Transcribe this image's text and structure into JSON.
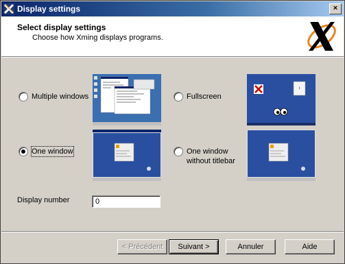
{
  "window": {
    "title": "Display settings",
    "close_glyph": "×"
  },
  "header": {
    "title": "Select display settings",
    "subtitle": "Choose how Xming displays programs.",
    "logo_icon": "xming-logo-icon"
  },
  "options": [
    {
      "label": "Multiple windows",
      "checked": false
    },
    {
      "label": "Fullscreen",
      "checked": false
    },
    {
      "label": "One window",
      "checked": true
    },
    {
      "label": "One window",
      "label_line2": "without titlebar",
      "checked": false
    }
  ],
  "display_number": {
    "label": "Display number",
    "value": "0"
  },
  "buttons": {
    "back": "< Précédent",
    "next": "Suivant >",
    "cancel": "Annuler",
    "help": "Aide"
  },
  "colors": {
    "title_gradient_start": "#0a246a",
    "desktop_blue": "#2a4fa0",
    "logo_orange": "#e8871e"
  }
}
